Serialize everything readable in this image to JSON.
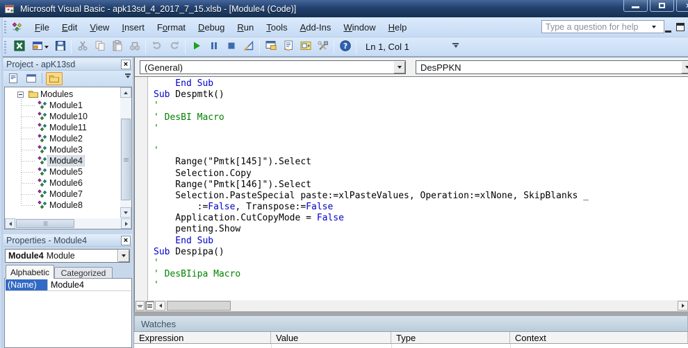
{
  "window": {
    "title": "Microsoft Visual Basic - apk13sd_4_2017_7_15.xlsb - [Module4 (Code)]"
  },
  "menu_bar": {
    "items": [
      {
        "label": "File",
        "u": 0
      },
      {
        "label": "Edit",
        "u": 0
      },
      {
        "label": "View",
        "u": 0
      },
      {
        "label": "Insert",
        "u": 0
      },
      {
        "label": "Format",
        "u": 1
      },
      {
        "label": "Debug",
        "u": 0
      },
      {
        "label": "Run",
        "u": 0
      },
      {
        "label": "Tools",
        "u": 0
      },
      {
        "label": "Add-Ins",
        "u": 0
      },
      {
        "label": "Window",
        "u": 0
      },
      {
        "label": "Help",
        "u": 0
      }
    ],
    "help_box_placeholder": "Type a question for help"
  },
  "toolbar": {
    "groups": [
      [
        "view-microsoft-excel",
        "insert-userform",
        "save"
      ],
      [
        "cut",
        "copy",
        "paste",
        "find"
      ],
      [
        "undo",
        "redo"
      ],
      [
        "run",
        "break",
        "reset",
        "design-mode"
      ],
      [
        "project-explorer",
        "properties-window",
        "object-browser",
        "toolbox"
      ],
      [
        "help"
      ]
    ],
    "position_label": "Ln 1, Col 1"
  },
  "project_panel": {
    "title": "Project - apK13sd",
    "toolbar_icons": [
      "view-code",
      "view-object",
      "toggle-folders"
    ],
    "folder_label": "Modules",
    "modules": [
      "Module1",
      "Module10",
      "Module11",
      "Module2",
      "Module3",
      "Module4",
      "Module5",
      "Module6",
      "Module7",
      "Module8"
    ],
    "selected_module": "Module4"
  },
  "properties_panel": {
    "title": "Properties - Module4",
    "object_name": "Module4",
    "object_type": "Module",
    "tabs": [
      "Alphabetic",
      "Categorized"
    ],
    "rows": [
      {
        "name": "(Name)",
        "value": "Module4"
      }
    ]
  },
  "code_window": {
    "object_dropdown": "(General)",
    "procedure_dropdown": "DesPPKN",
    "lines": [
      [
        {
          "c": "k",
          "t": "    End Sub"
        }
      ],
      [
        {
          "c": "k",
          "t": "Sub"
        },
        {
          "c": "n",
          "t": " Despmtk()"
        }
      ],
      [
        {
          "c": "c",
          "t": "'"
        }
      ],
      [
        {
          "c": "c",
          "t": "' DesBI Macro"
        }
      ],
      [
        {
          "c": "c",
          "t": "'"
        }
      ],
      [],
      [
        {
          "c": "c",
          "t": "'"
        }
      ],
      [
        {
          "c": "n",
          "t": "    Range(\"Pmtk[145]\").Select"
        }
      ],
      [
        {
          "c": "n",
          "t": "    Selection.Copy"
        }
      ],
      [
        {
          "c": "n",
          "t": "    Range(\"Pmtk[146]\").Select"
        }
      ],
      [
        {
          "c": "n",
          "t": "    Selection.PasteSpecial paste:=xlPasteValues, Operation:=xlNone, SkipBlanks _"
        }
      ],
      [
        {
          "c": "n",
          "t": "        :="
        },
        {
          "c": "k",
          "t": "False"
        },
        {
          "c": "n",
          "t": ", Transpose:="
        },
        {
          "c": "k",
          "t": "False"
        }
      ],
      [
        {
          "c": "n",
          "t": "    Application.CutCopyMode = "
        },
        {
          "c": "k",
          "t": "False"
        }
      ],
      [
        {
          "c": "n",
          "t": "    penting.Show"
        }
      ],
      [
        {
          "c": "k",
          "t": "    End Sub"
        }
      ],
      [
        {
          "c": "k",
          "t": "Sub"
        },
        {
          "c": "n",
          "t": " Despipa()"
        }
      ],
      [
        {
          "c": "c",
          "t": "'"
        }
      ],
      [
        {
          "c": "c",
          "t": "' DesBIipa Macro"
        }
      ],
      [
        {
          "c": "c",
          "t": "'"
        }
      ]
    ]
  },
  "watches_panel": {
    "title": "Watches",
    "columns": [
      "Expression",
      "Value",
      "Type",
      "Context"
    ]
  },
  "colors": {
    "keyword": "#0000cc",
    "comment": "#008200",
    "title_bar": "#22416e",
    "selection": "#316ac5"
  }
}
